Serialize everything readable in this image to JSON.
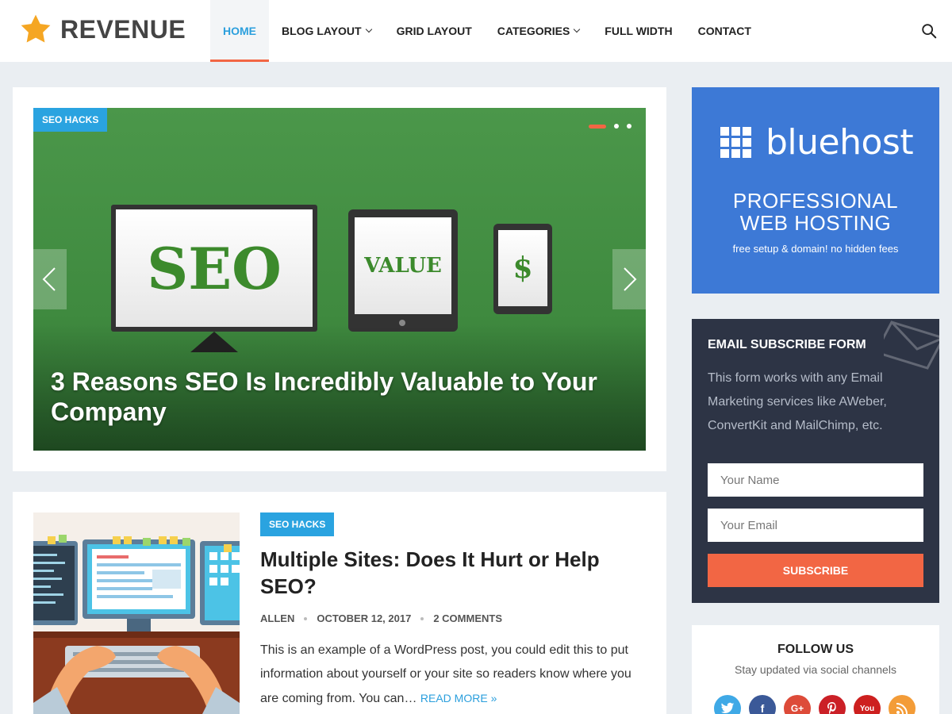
{
  "site": {
    "name": "REVENUE"
  },
  "nav": {
    "items": [
      {
        "label": "HOME"
      },
      {
        "label": "BLOG LAYOUT"
      },
      {
        "label": "GRID LAYOUT"
      },
      {
        "label": "CATEGORIES"
      },
      {
        "label": "FULL WIDTH"
      },
      {
        "label": "CONTACT"
      }
    ],
    "active": "HOME"
  },
  "slider": {
    "category": "SEO HACKS",
    "title": "3 Reasons SEO Is Incredibly Valuable to Your Company",
    "monitor_text": "SEO",
    "tablet_text": "VALUE",
    "phone_text": "$"
  },
  "post": {
    "category": "SEO HACKS",
    "title": "Multiple Sites: Does It Hurt or Help SEO?",
    "author": "ALLEN",
    "date": "OCTOBER 12, 2017",
    "comments": "2 COMMENTS",
    "excerpt": "This is an example of a WordPress post, you could edit this to put information about yourself or your site so readers know where you are coming from. You can…",
    "read_more": "READ MORE »"
  },
  "ad": {
    "brand": "bluehost",
    "line1": "PROFESSIONAL",
    "line2": "WEB HOSTING",
    "line3": "free setup & domain! no hidden fees"
  },
  "subscribe": {
    "title": "EMAIL SUBSCRIBE FORM",
    "text": "This form works with any Email Marketing services like AWeber, ConvertKit and MailChimp, etc.",
    "name_placeholder": "Your Name",
    "email_placeholder": "Your Email",
    "button": "SUBSCRIBE"
  },
  "follow": {
    "title": "FOLLOW US",
    "subtitle": "Stay updated via social channels",
    "icons": [
      "twitter-icon",
      "facebook-icon",
      "google-plus-icon",
      "pinterest-icon",
      "youtube-icon",
      "rss-icon"
    ],
    "glyphs": {
      "facebook": "f",
      "google_plus": "G+",
      "youtube": "You"
    }
  },
  "colors": {
    "accent": "#2b9fdd",
    "highlight": "#f26644",
    "badge": "#2aa3e0",
    "ad_bg": "#3d79d6",
    "form_bg": "#2d3445"
  }
}
